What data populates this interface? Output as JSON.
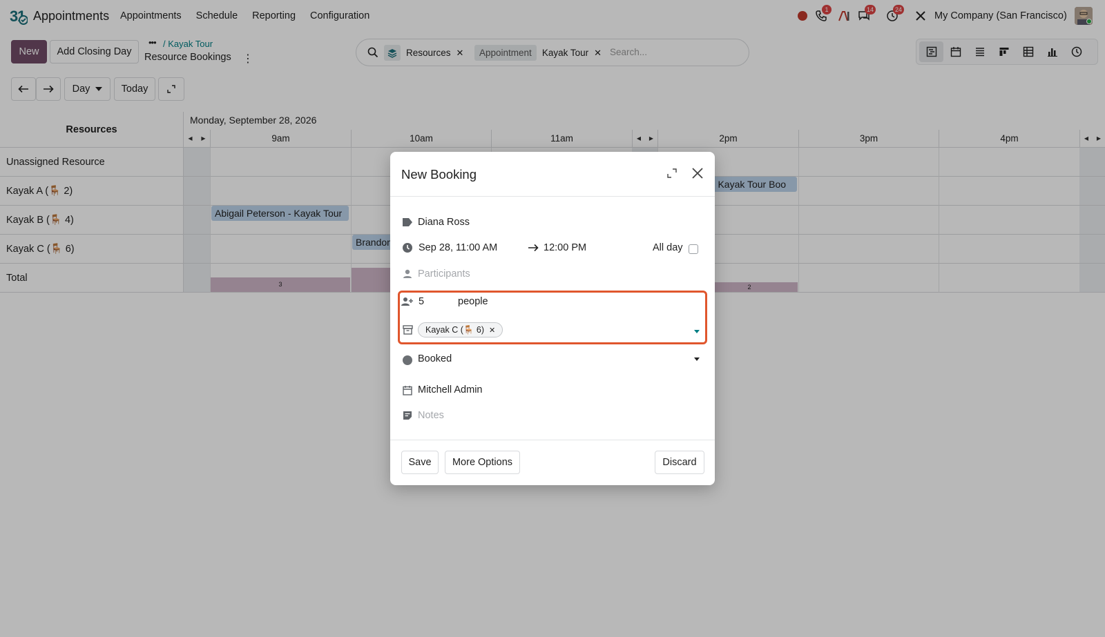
{
  "app": {
    "name": "Appointments"
  },
  "menu": [
    "Appointments",
    "Schedule",
    "Reporting",
    "Configuration"
  ],
  "systray": {
    "calls_badge": "1",
    "messages_badge": "14",
    "activities_badge": "24",
    "company": "My Company (San Francisco)"
  },
  "control": {
    "new_label": "New",
    "closing_day_label": "Add Closing Day",
    "breadcrumb_parent": "Kayak Tour",
    "breadcrumb_dots": "•••",
    "page_title": "Resource Bookings"
  },
  "search": {
    "facet_resources": "Resources",
    "facet_appointment_label": "Appointment",
    "facet_appointment_value": "Kayak Tour",
    "placeholder": "Search..."
  },
  "nav": {
    "scale_label": "Day",
    "today_label": "Today"
  },
  "gantt": {
    "header_label": "Resources",
    "date_label": "Monday, September 28, 2026",
    "columns": [
      "9am",
      "10am",
      "11am",
      "2pm",
      "3pm",
      "4pm"
    ],
    "rows": [
      "Unassigned Resource",
      "Kayak A (🪑 2)",
      "Kayak B (🪑 4)",
      "Kayak C (🪑 6)",
      "Total"
    ],
    "pills": [
      {
        "label": "Abigail Peterson - Kayak Tour"
      },
      {
        "label": "Brandon"
      },
      {
        "label": "z - Kayak Tour Boo"
      }
    ],
    "totals": [
      "3",
      "2"
    ]
  },
  "dialog": {
    "title": "New Booking",
    "customer": "Diana Ross",
    "start": "Sep 28, 11:00 AM",
    "end": "12:00 PM",
    "all_day_label": "All day",
    "participants_placeholder": "Participants",
    "capacity": "5",
    "capacity_unit": "people",
    "resource_tag": "Kayak C (🪑 6)",
    "state": "Booked",
    "organizer": "Mitchell Admin",
    "notes_placeholder": "Notes",
    "save_label": "Save",
    "more_options_label": "More Options",
    "discard_label": "Discard"
  },
  "colors": {
    "primary": "#714b67",
    "highlight": "#e0562d",
    "pill": "#bcd3ea",
    "total_bar": "#cfb6c8"
  }
}
